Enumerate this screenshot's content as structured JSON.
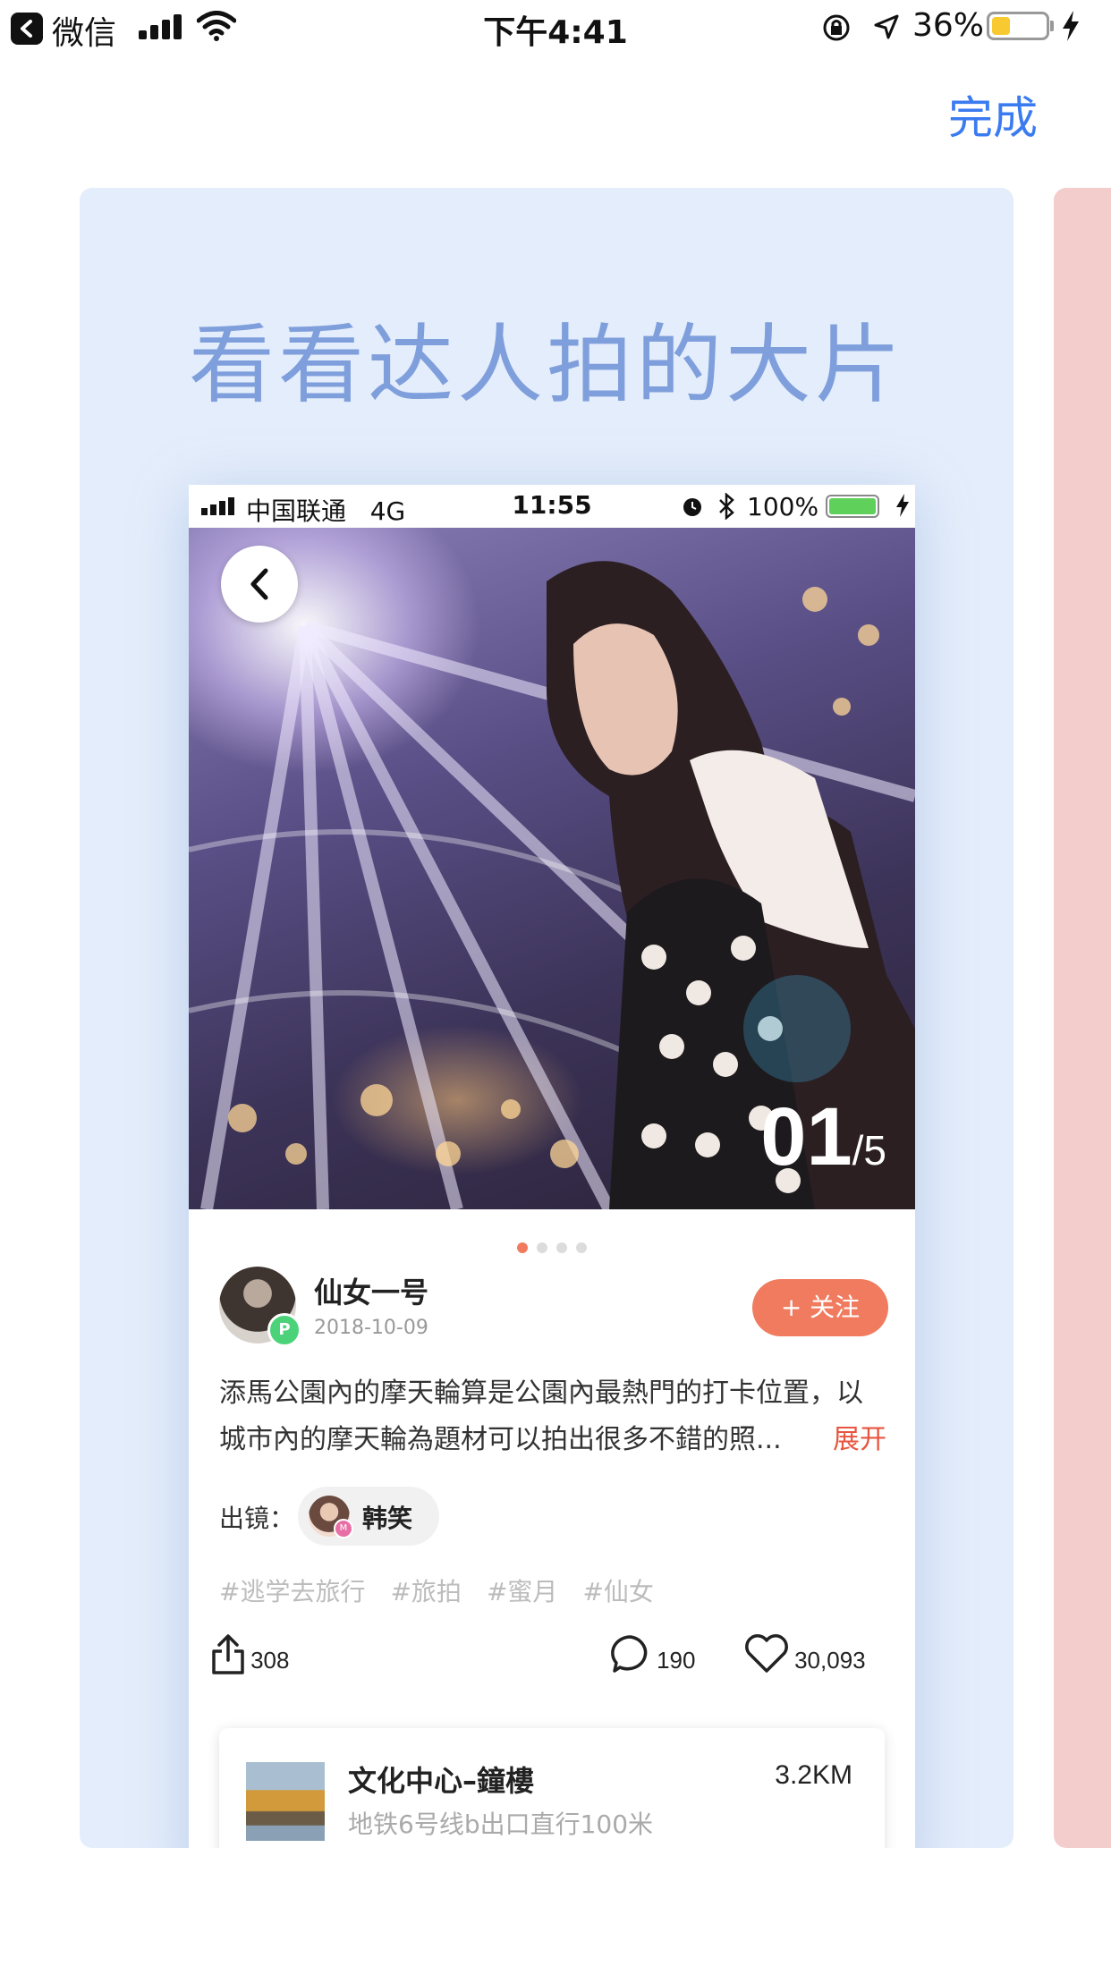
{
  "status_bar": {
    "app_name": "微信",
    "time": "下午4:41",
    "battery_percent_text": "36%",
    "battery_level": 0.36
  },
  "header": {
    "done_label": "完成"
  },
  "promo": {
    "headline": "看看达人拍的大片"
  },
  "phone_status": {
    "carrier": "中国联通",
    "network": "4G",
    "time": "11:55",
    "battery_percent_text": "100%"
  },
  "gallery": {
    "current": "01",
    "total": "/5",
    "dot_count": 4,
    "active_dot": 0
  },
  "post": {
    "author": "仙女一号",
    "author_badge": "P",
    "date": "2018-10-09",
    "follow_label": "+ 关注",
    "description": "添馬公園內的摩天輪算是公園內最熱門的打卡位置，以城市內的摩天輪為題材可以拍出很多不錯的照...",
    "expand_label": "展开",
    "appearance_label": "出镜：",
    "model_name": "韩笑",
    "model_badge": "M",
    "tags": [
      "#逃学去旅行",
      "#旅拍",
      "#蜜月",
      "#仙女"
    ],
    "shares": "308",
    "comments": "190",
    "likes": "30,093"
  },
  "location": {
    "title": "文化中心–鐘樓",
    "subtitle": "地铁6号线b出口直行100米",
    "distance": "3.2KM"
  },
  "colors": {
    "accent_blue": "#3b7bf0",
    "card_bg": "#e4edfb",
    "headline": "#7f9fdc",
    "follow": "#f07b5f",
    "expand": "#e8553f",
    "side_card": "#f3cccc"
  }
}
